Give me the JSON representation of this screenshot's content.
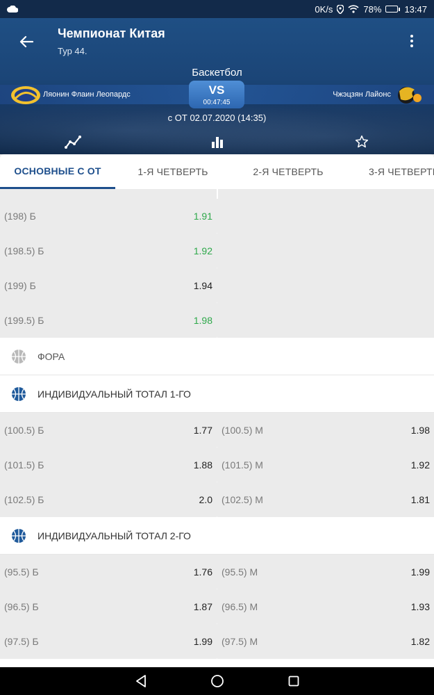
{
  "status": {
    "net_speed": "0K/s",
    "battery": "78%",
    "battery_level": 0.78,
    "time": "13:47"
  },
  "header": {
    "title": "Чемпионат Китая",
    "subtitle": "Тур 44.",
    "sport": "Баскетбол",
    "team_left": "Ляонин Флаин Леопардс",
    "team_right": "Чжэцзян Лайонс",
    "vs": "VS",
    "timer": "00:47:45",
    "date": "с ОТ 02.07.2020 (14:35)",
    "icons": [
      "chart-line-icon",
      "bar-chart-icon",
      "star-icon"
    ]
  },
  "tabs": [
    {
      "label": "ОСНОВНЫЕ С ОТ",
      "active": true
    },
    {
      "label": "1-Я ЧЕТВЕРТЬ",
      "active": false
    },
    {
      "label": "2-Я ЧЕТВЕРТЬ",
      "active": false
    },
    {
      "label": "3-Я ЧЕТВЕРТЬ",
      "active": false
    }
  ],
  "total_rows": [
    {
      "label": "(198) Б",
      "odd": "1.91",
      "green": true
    },
    {
      "label": "(198.5) Б",
      "odd": "1.92",
      "green": true
    },
    {
      "label": "(199) Б",
      "odd": "1.94",
      "green": false
    },
    {
      "label": "(199.5) Б",
      "odd": "1.98",
      "green": true
    }
  ],
  "sections": {
    "fora": "ФОРА",
    "ind1": "ИНДИВИДУАЛЬНЫЙ ТОТАЛ 1-ГО",
    "ind2": "ИНДИВИДУАЛЬНЫЙ ТОТАЛ 2-ГО"
  },
  "ind1_rows": [
    {
      "left_label": "(100.5) Б",
      "left_odd": "1.77",
      "right_label": "(100.5) М",
      "right_odd": "1.98"
    },
    {
      "left_label": "(101.5) Б",
      "left_odd": "1.88",
      "right_label": "(101.5) М",
      "right_odd": "1.92"
    },
    {
      "left_label": "(102.5) Б",
      "left_odd": "2.0",
      "right_label": "(102.5) М",
      "right_odd": "1.81"
    }
  ],
  "ind2_rows": [
    {
      "left_label": "(95.5) Б",
      "left_odd": "1.76",
      "right_label": "(95.5) М",
      "right_odd": "1.99"
    },
    {
      "left_label": "(96.5) Б",
      "left_odd": "1.87",
      "right_label": "(96.5) М",
      "right_odd": "1.93"
    },
    {
      "left_label": "(97.5) Б",
      "left_odd": "1.99",
      "right_label": "(97.5) М",
      "right_odd": "1.82"
    }
  ],
  "colors": {
    "header_blue": "#1b4577",
    "accent": "#1e4f8c",
    "odd_green": "#2ea84a"
  },
  "navbar": [
    "back-triangle-icon",
    "home-circle-icon",
    "recents-square-icon"
  ]
}
